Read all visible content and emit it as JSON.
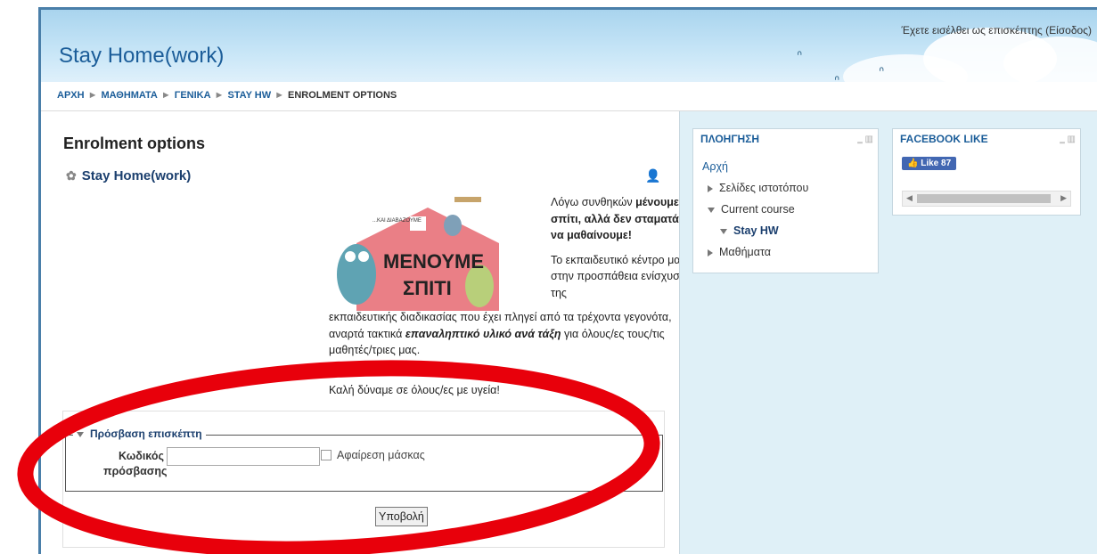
{
  "header": {
    "site_title": "Stay Home(work)",
    "login_text": "Έχετε εισέλθει ως επισκέπτης (",
    "login_link": "Είσοδος",
    "login_close": ")"
  },
  "breadcrumb": {
    "items": [
      "ΑΡΧΗ",
      "ΜΑΘΗΜΑΤΑ",
      "ΓΕΝΙΚΑ",
      "STAY HW",
      "ENROLMENT OPTIONS"
    ],
    "separator": "►"
  },
  "main": {
    "heading": "Enrolment options",
    "course_name": "Stay Home(work)",
    "summary_intro_1": "Λόγω συνθηκών ",
    "summary_intro_bold": "μένουμε σπίτι, αλλά δεν σταματάμε να μαθαίνουμε!",
    "summary_p2_a": "Το εκπαιδευτικό κέντρο μας στην προσπάθεια ενίσχυσης της",
    "summary_p2_b": "εκπαιδευτικής διαδικασίας που έχει πληγεί από τα τρέχοντα γεγονότα, αναρτά τακτικά ",
    "summary_p2_bold": "επαναληπτικό υλικό ανά τάξη",
    "summary_p2_c": " για όλους/ες τους/τις μαθητές/τριες μας.",
    "greeting": "Καλή δύναμε σε όλους/ες με υγεία!",
    "image": {
      "top_text": "...ΚΑΙ ΔΙΑΒΑΖΟΥΜΕ",
      "big_1": "ΜΕΝΟΥΜΕ",
      "big_2": "ΣΠΙΤΙ"
    }
  },
  "guest_form": {
    "legend": "Πρόσβαση επισκέπτη",
    "password_label": "Κωδικός πρόσβασης",
    "password_value": "",
    "unmask_label": "Αφαίρεση μάσκας",
    "submit_label": "Υποβολή"
  },
  "navigation_block": {
    "title": "ΠΛΟΗΓΗΣΗ",
    "home": "Αρχή",
    "site_pages": "Σελίδες ιστοτόπου",
    "current_course": "Current course",
    "course": "Stay HW",
    "courses": "Μαθήματα"
  },
  "facebook_block": {
    "title": "FACEBOOK LIKE",
    "like_label": "Like 87"
  },
  "colors": {
    "brand": "#1b5d99",
    "annotation": "#e8000b"
  }
}
